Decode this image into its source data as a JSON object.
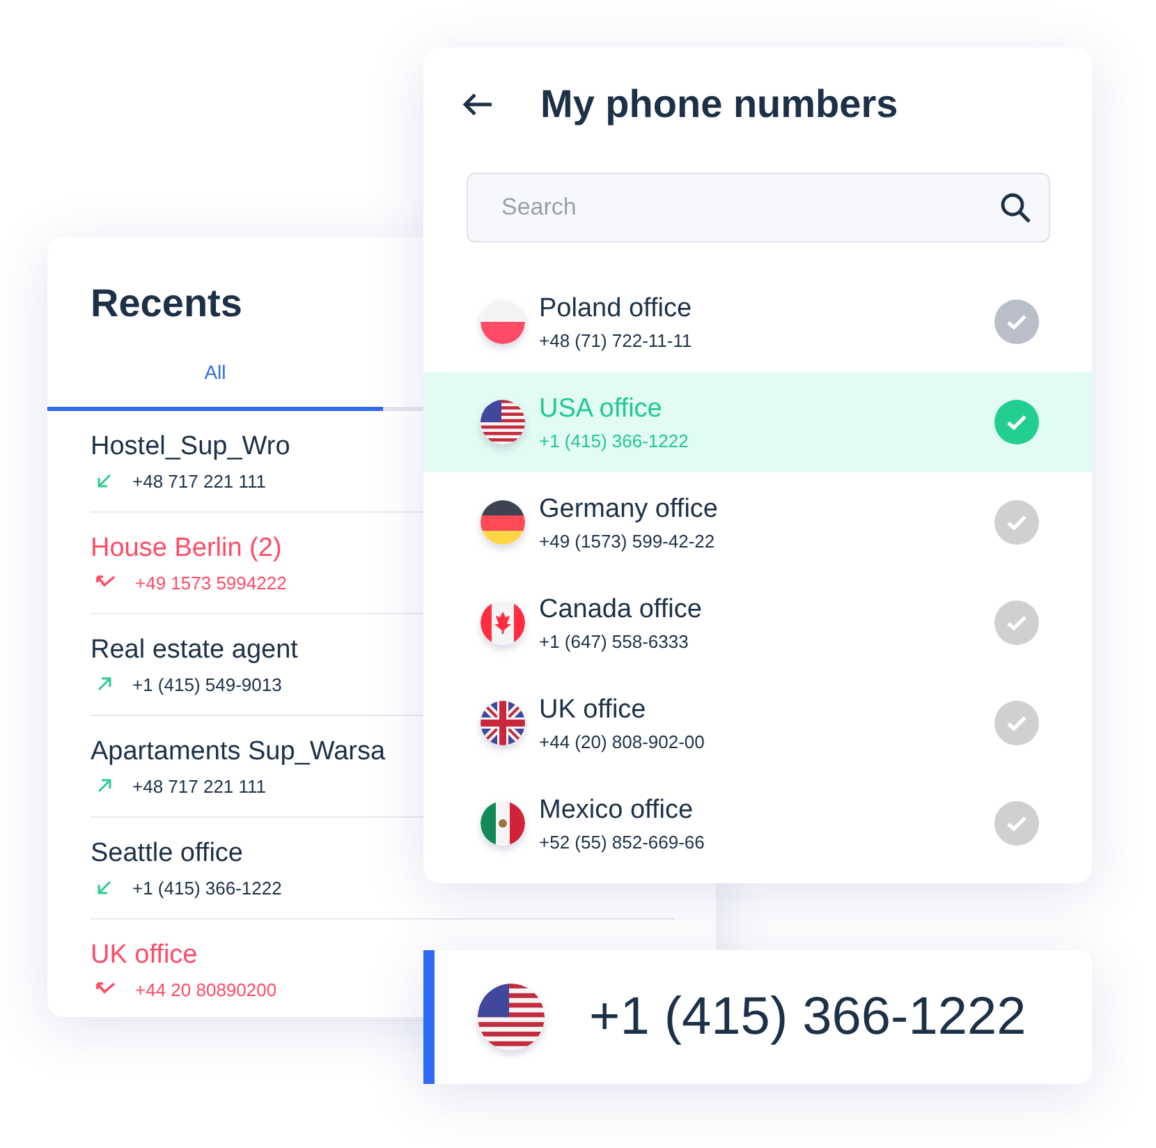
{
  "recents": {
    "title": "Recents",
    "tabs": [
      {
        "label": "All",
        "selected": true
      }
    ],
    "calls": [
      {
        "name": "Hostel_Sup_Wro",
        "number": "+48 717 221 111",
        "kind": "incoming"
      },
      {
        "name": "House Berlin (2)",
        "number": "+49 1573 5994222",
        "kind": "missed"
      },
      {
        "name": "Real estate agent",
        "number": "+1 (415) 549-9013",
        "kind": "outgoing"
      },
      {
        "name": "Apartaments Sup_Warsa",
        "number": "+48 717 221 111",
        "kind": "outgoing"
      },
      {
        "name": "Seattle office",
        "number": "+1 (415) 366-1222",
        "kind": "incoming"
      },
      {
        "name": "UK office",
        "number": "+44 20 80890200",
        "kind": "missed"
      }
    ]
  },
  "phone_numbers": {
    "title": "My phone numbers",
    "search": {
      "placeholder": "Search"
    },
    "items": [
      {
        "name": "Poland office",
        "number": "+48 (71) 722-11-11",
        "kind": "pl",
        "selected": false
      },
      {
        "name": "USA office",
        "number": "+1 (415) 366-1222",
        "kind": "us",
        "selected": true
      },
      {
        "name": "Germany office",
        "number": "+49 (1573) 599-42-22",
        "kind": "de",
        "selected": false
      },
      {
        "name": "Canada office",
        "number": "+1 (647) 558-6333",
        "kind": "ca",
        "selected": false
      },
      {
        "name": "UK office",
        "number": "+44 (20) 808-902-00",
        "kind": "gb",
        "selected": false
      },
      {
        "name": "Mexico office",
        "number": "+52 (55) 852-669-66",
        "kind": "mx",
        "selected": false
      }
    ]
  },
  "caller_id": {
    "number": "+1 (415) 366-1222",
    "kind": "us"
  }
}
